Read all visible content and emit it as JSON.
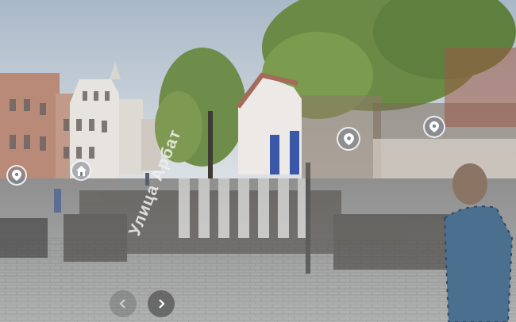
{
  "street_sign": {
    "text": "Улица Арбат"
  },
  "hotspots": [
    {
      "icon": "map-pin-icon"
    },
    {
      "icon": "home-icon"
    },
    {
      "icon": "map-pin-icon"
    },
    {
      "icon": "map-pin-icon"
    }
  ],
  "navigation": {
    "prev_icon": "chevron-left-icon",
    "next_icon": "chevron-right-icon"
  },
  "colors": {
    "sky": "#c9d3df",
    "foliage": "#6f8d4a",
    "building_left": "#b98a78",
    "pavement": "#9ea1a3",
    "hotspot_bg": "#7a8790"
  }
}
